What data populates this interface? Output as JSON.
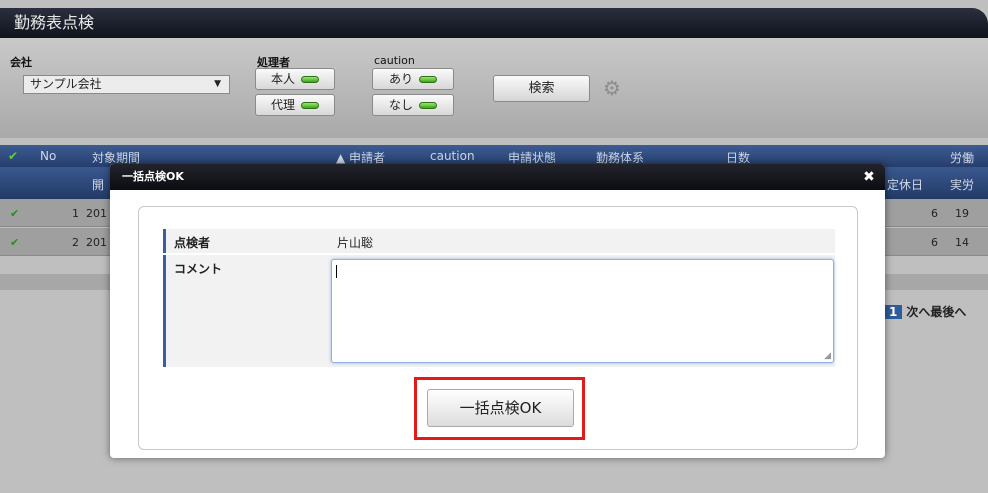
{
  "page": {
    "title": "勤務表点検",
    "filters": {
      "company_label": "会社",
      "company_value": "サンプル会社",
      "handler_label": "処理者",
      "handler_self": "本人",
      "handler_proxy": "代理",
      "caution_label": "caution",
      "caution_yes": "あり",
      "caution_no": "なし",
      "search_button": "検索"
    },
    "grid": {
      "headers": [
        "No",
        "対象期間",
        "▲ 申請者",
        "caution",
        "申請状態",
        "勤務体系",
        "日数",
        "労働"
      ],
      "subheaders": [
        "開",
        "定休日",
        "実労"
      ],
      "rows": [
        {
          "no": "1",
          "period": "201",
          "days": "6",
          "work": "19"
        },
        {
          "no": "2",
          "period": "201",
          "days": "6",
          "work": "14"
        }
      ]
    },
    "pager": {
      "current": "1",
      "next": "次へ",
      "last": "最後へ"
    }
  },
  "modal": {
    "title": "一括点検OK",
    "inspector_label": "点検者",
    "inspector_value": "片山聡",
    "comment_label": "コメント",
    "comment_value": "",
    "ok_button": "一括点検OK"
  }
}
